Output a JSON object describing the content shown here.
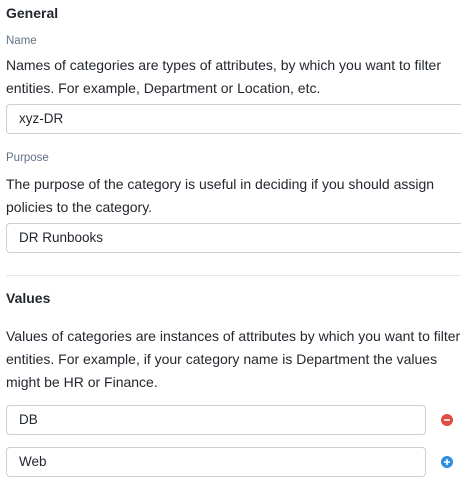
{
  "general": {
    "title": "General",
    "name_label": "Name",
    "name_description": "Names of categories are types of attributes, by which you want to filter entities. For example, Department or Location, etc.",
    "name_value": "xyz-DR",
    "purpose_label": "Purpose",
    "purpose_description": "The purpose of the category is useful in deciding if you should assign policies to the category.",
    "purpose_value": "DR Runbooks"
  },
  "values": {
    "title": "Values",
    "description": "Values of categories are instances of attributes by which you want to filter entities. For example, if your category name is Department the values might be HR or Finance.",
    "items": [
      {
        "value": "DB",
        "action_icon": "remove-icon",
        "action_color": "#e04b44"
      },
      {
        "value": "Web",
        "action_icon": "add-icon",
        "action_color": "#2f8fe0"
      }
    ]
  }
}
